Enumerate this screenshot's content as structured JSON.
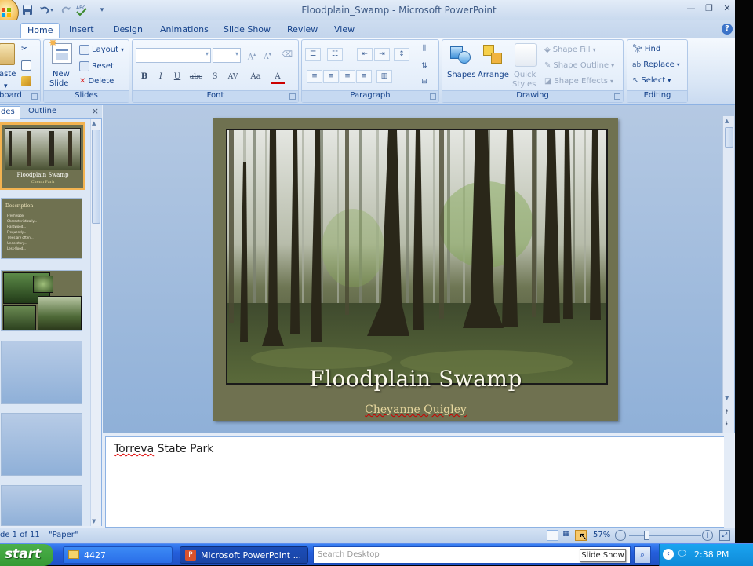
{
  "window": {
    "title": "Floodplain_Swamp - Microsoft PowerPoint"
  },
  "ribbon_tabs": [
    {
      "label": "Home",
      "active": true
    },
    {
      "label": "Insert"
    },
    {
      "label": "Design"
    },
    {
      "label": "Animations"
    },
    {
      "label": "Slide Show"
    },
    {
      "label": "Review"
    },
    {
      "label": "View"
    }
  ],
  "ribbon": {
    "clipboard": {
      "paste": "aste",
      "label": "board"
    },
    "slides": {
      "new_slide_1": "New",
      "new_slide_2": "Slide",
      "layout": "Layout",
      "reset": "Reset",
      "delete": "Delete",
      "label": "Slides"
    },
    "font": {
      "label": "Font",
      "buttons": [
        "B",
        "I",
        "U",
        "abc",
        "S",
        "AV",
        "Aa",
        "A"
      ]
    },
    "paragraph": {
      "label": "Paragraph"
    },
    "drawing": {
      "shapes": "Shapes",
      "arrange": "Arrange",
      "quick_styles_1": "Quick",
      "quick_styles_2": "Styles",
      "shape_fill": "Shape Fill",
      "shape_outline": "Shape Outline",
      "shape_effects": "Shape Effects",
      "label": "Drawing"
    },
    "editing": {
      "find": "Find",
      "replace": "Replace",
      "select": "Select",
      "label": "Editing"
    }
  },
  "left_pane": {
    "tabs": [
      "des",
      "Outline"
    ],
    "thumbnails": [
      {
        "title": "Floodplain Swamp",
        "subtitle": "Chenn Parh",
        "selected": true
      },
      {
        "title": "Description",
        "bullets": [
          "Freshwater",
          "Characteristically...",
          "Hardwood...",
          "Frequently...",
          "Trees are often...",
          "Understory...",
          "Less-flood..."
        ]
      },
      {
        "title": ""
      },
      {
        "title": ""
      },
      {
        "title": ""
      },
      {
        "title": ""
      }
    ]
  },
  "slide": {
    "title": "Floodplain Swamp",
    "subtitle": "Cheyanne Quigley"
  },
  "notes": {
    "text_underlined": "Torreva",
    "text_rest": " State Park"
  },
  "status_bar": {
    "slide_info": "de 1 of 11",
    "theme": "\"Paper\"",
    "zoom": "57%"
  },
  "taskbar": {
    "start": "start",
    "items": [
      "4427",
      "Microsoft PowerPoint ..."
    ],
    "search_placeholder": "Search Desktop",
    "time": "2:38 PM"
  },
  "tooltip": "Slide Show",
  "colors": {
    "accent": "#15428b",
    "selection": "#f3b351",
    "slide_bg": "#6f7150"
  }
}
